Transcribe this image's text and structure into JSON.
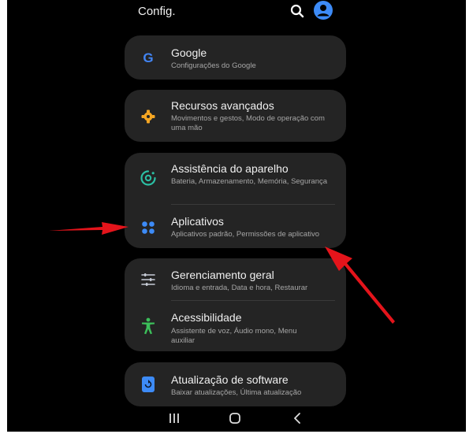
{
  "header": {
    "title": "Config."
  },
  "cards": {
    "google": {
      "title": "Google",
      "subtitle": "Configurações do Google"
    },
    "advanced": {
      "title": "Recursos avançados",
      "subtitle": "Movimentos e gestos, Modo de operação com uma mão"
    },
    "device_care": {
      "title": "Assistência do aparelho",
      "subtitle": "Bateria, Armazenamento, Memória, Segurança"
    },
    "apps": {
      "title": "Aplicativos",
      "subtitle": "Aplicativos padrão, Permissões de aplicativo"
    },
    "general": {
      "title": "Gerenciamento geral",
      "subtitle": "Idioma e entrada, Data e hora, Restaurar"
    },
    "accessibility": {
      "title": "Acessibilidade",
      "subtitle": "Assistente de voz, Áudio mono, Menu auxiliar"
    },
    "software_update": {
      "title": "Atualização de software",
      "subtitle": "Baixar atualizações, Última atualização"
    }
  },
  "icons": {
    "search": "search-icon",
    "avatar": "account-icon",
    "google": "google-g-icon",
    "advanced": "puzzle-gear-icon",
    "device_care": "device-care-icon",
    "apps": "apps-grid-icon",
    "general": "sliders-icon",
    "accessibility": "accessibility-person-icon",
    "software_update": "update-icon",
    "nav_recents": "recents-icon",
    "nav_home": "home-icon",
    "nav_back": "back-icon"
  },
  "colors": {
    "background": "#000000",
    "card": "#242424",
    "accent_blue": "#3d8bf7",
    "google_blue": "#4285f4",
    "advanced_orange": "#f5a623",
    "device_care_teal": "#2bbfa4",
    "general_gray": "#c7ccd6",
    "accessibility_green": "#3cbf5a",
    "annotation_red": "#e4141b"
  }
}
